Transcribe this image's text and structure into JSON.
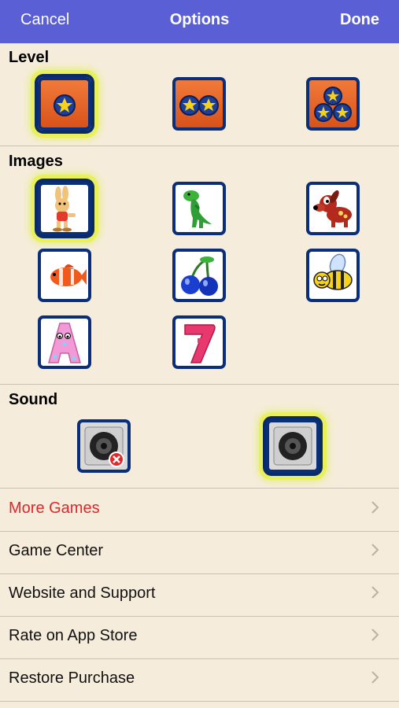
{
  "header": {
    "cancel_label": "Cancel",
    "title": "Options",
    "done_label": "Done"
  },
  "sections": {
    "level_title": "Level",
    "images_title": "Images",
    "sound_title": "Sound"
  },
  "level_options": [
    {
      "icon": "one-star-coin-icon",
      "selected": true
    },
    {
      "icon": "two-star-coins-icon",
      "selected": false
    },
    {
      "icon": "three-star-coins-icon",
      "selected": false
    }
  ],
  "image_options": [
    {
      "icon": "rabbit-icon",
      "selected": true
    },
    {
      "icon": "dinosaur-icon",
      "selected": false
    },
    {
      "icon": "dog-icon",
      "selected": false
    },
    {
      "icon": "clownfish-icon",
      "selected": false
    },
    {
      "icon": "cherries-icon",
      "selected": false
    },
    {
      "icon": "bee-icon",
      "selected": false
    },
    {
      "icon": "letter-a-icon",
      "selected": false
    },
    {
      "icon": "number-seven-icon",
      "selected": false
    }
  ],
  "sound_options": [
    {
      "icon": "speaker-muted-icon",
      "selected": false
    },
    {
      "icon": "speaker-on-icon",
      "selected": true
    }
  ],
  "menu": [
    {
      "label": "More Games",
      "color": "#e0262a"
    },
    {
      "label": "Game Center"
    },
    {
      "label": "Website and Support"
    },
    {
      "label": "Rate on App Store"
    },
    {
      "label": "Restore Purchase"
    }
  ],
  "colors": {
    "navbar": "#5a5fd6",
    "background": "#f6ecdb",
    "tile_border": "#0a2f7a",
    "selection_glow": "#e9f05a"
  }
}
